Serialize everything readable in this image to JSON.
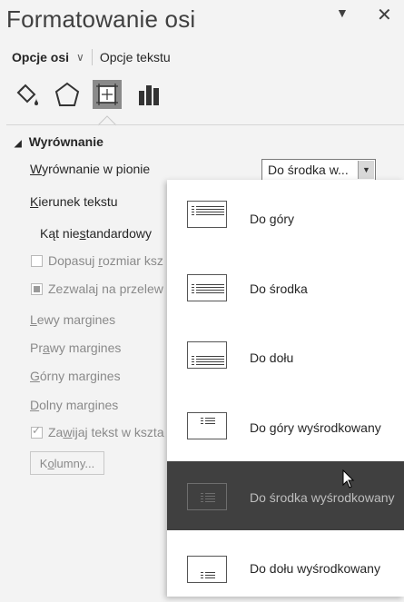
{
  "pane": {
    "title": "Formatowanie osi",
    "pin_icon": "chevron-down-icon",
    "close_icon": "close-icon",
    "close_glyph": "✕",
    "pin_glyph": "▼"
  },
  "tabs": {
    "active": "Opcje osi",
    "chevron": "∨",
    "other": "Opcje tekstu"
  },
  "icon_tabs": [
    {
      "name": "fill-line-icon"
    },
    {
      "name": "effects-pentagon-icon"
    },
    {
      "name": "size-properties-icon",
      "selected": true
    },
    {
      "name": "axis-options-icon"
    }
  ],
  "section": {
    "collapse": "◢",
    "title": "Wyrównanie"
  },
  "fields": {
    "vertical_align": {
      "prefix": "W",
      "rest": "yrównanie w pionie",
      "value": "Do środka w..."
    },
    "text_direction": {
      "prefix": "K",
      "rest": "ierunek tekstu"
    },
    "custom_angle": {
      "pre": "Kąt nie",
      "u": "s",
      "post": "tandardowy"
    },
    "autofit": {
      "pre": "Dopasuj ",
      "u": "r",
      "post": "ozmiar ksz"
    },
    "overflow": {
      "label": "Zezwalaj na przelew"
    },
    "left_margin": {
      "u": "L",
      "post": "ewy margines"
    },
    "right_margin": {
      "pre": "Pr",
      "u": "a",
      "post": "wy margines"
    },
    "top_margin": {
      "u": "G",
      "post": "órny margines"
    },
    "bottom_margin": {
      "u": "D",
      "post": "olny margines"
    },
    "wrap": {
      "pre": "Za",
      "u": "w",
      "post": "ijaj tekst w kszta"
    },
    "columns_btn": {
      "pre": "K",
      "u": "o",
      "post": "lumny..."
    }
  },
  "dropdown": {
    "items": [
      {
        "label": "Do góry",
        "icon": "align-top-icon"
      },
      {
        "label": "Do środka",
        "icon": "align-middle-icon"
      },
      {
        "label": "Do dołu",
        "icon": "align-bottom-icon"
      },
      {
        "label": "Do góry wyśrodkowany",
        "icon": "align-top-centered-icon"
      },
      {
        "label": "Do środka wyśrodkowany",
        "icon": "align-middle-centered-icon",
        "hovered": true
      },
      {
        "label": "Do dołu wyśrodkowany",
        "icon": "align-bottom-centered-icon"
      }
    ]
  },
  "colors": {
    "pane_bg": "#f3f3f3",
    "hover_bg": "#404040",
    "selected_icon_bg": "#8a8a8a"
  }
}
